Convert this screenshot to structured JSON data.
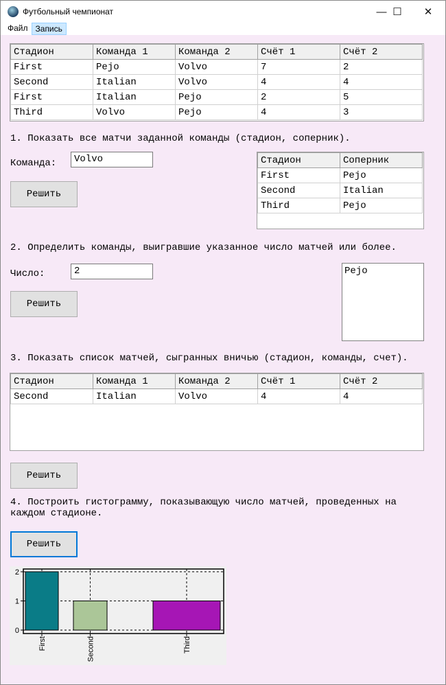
{
  "window": {
    "title": "Футбольный чемпионат",
    "minimize": "—",
    "maximize": "☐",
    "close": "✕"
  },
  "menu": [
    "Файл",
    "Запись"
  ],
  "main_table": {
    "headers": [
      "Стадион",
      "Команда 1",
      "Команда 2",
      "Счёт 1",
      "Счёт 2"
    ],
    "rows": [
      [
        "First",
        "Pejo",
        "Volvo",
        "7",
        "2"
      ],
      [
        "Second",
        "Italian",
        "Volvo",
        "4",
        "4"
      ],
      [
        "First",
        "Italian",
        "Pejo",
        "2",
        "5"
      ],
      [
        "Third",
        "Volvo",
        "Pejo",
        "4",
        "3"
      ]
    ]
  },
  "task1": {
    "title": "1. Показать все матчи заданной команды (стадион, соперник).",
    "label": "Команда:",
    "value": "Volvo",
    "button": "Решить",
    "table": {
      "headers": [
        "Стадион",
        "Соперник"
      ],
      "rows": [
        [
          "First",
          "Pejo"
        ],
        [
          "Second",
          "Italian"
        ],
        [
          "Third",
          "Pejo"
        ]
      ]
    }
  },
  "task2": {
    "title": "2. Определить команды, выигравшие указанное число матчей или более.",
    "label": "Число:",
    "value": "2",
    "button": "Решить",
    "result": [
      "Pejo"
    ]
  },
  "task3": {
    "title": "3. Показать список матчей, сыгранных вничью (стадион, команды, счет).",
    "button": "Решить",
    "table": {
      "headers": [
        "Стадион",
        "Команда 1",
        "Команда 2",
        "Счёт 1",
        "Счёт 2"
      ],
      "rows": [
        [
          "Second",
          "Italian",
          "Volvo",
          "4",
          "4"
        ]
      ]
    }
  },
  "task4": {
    "title_line1": "4. Построить гистограмму, показывающую число матчей, проведенных на",
    "title_line2": "каждом стадионе.",
    "button": "Решить"
  },
  "chart_data": {
    "type": "bar",
    "categories": [
      "First",
      "Second",
      "Third"
    ],
    "values": [
      2,
      1,
      1
    ],
    "ylim": [
      0,
      2
    ],
    "yticks": [
      "0",
      "1",
      "2"
    ],
    "grid": true,
    "colors": [
      "#0a7c87",
      "#abc698",
      "#a616b5"
    ]
  }
}
